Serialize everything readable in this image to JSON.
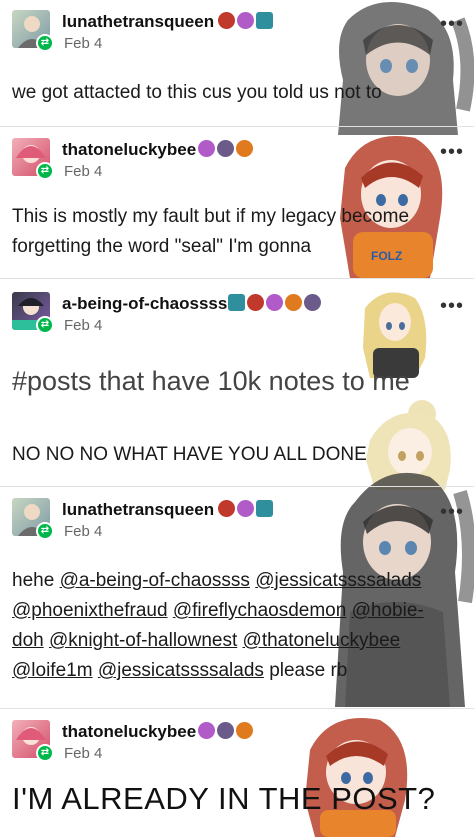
{
  "posts": [
    {
      "username": "lunathetransqueen",
      "date": "Feb 4",
      "body": "we got attacted to this cus you told us not to"
    },
    {
      "username": "thatoneluckybee",
      "date": "Feb 4",
      "body_line1": "This is mostly my fault but if my legacy become",
      "body_line2": "forgetting the word \"seal\" I'm gonna"
    },
    {
      "username": "a-being-of-chaossss",
      "date": "Feb 4",
      "tag": "#posts that have 10k notes to me",
      "body": "NO NO NO WHAT HAVE YOU ALL DONE"
    },
    {
      "username": "lunathetransqueen",
      "date": "Feb 4",
      "body_prefix": "hehe",
      "mentions": [
        "@a-being-of-chaossss",
        "@jessicatssssalads",
        "@phoenixthefraud",
        "@fireflychaosdemon",
        "@hobie-",
        "doh",
        "@knight-of-hallownest",
        "@thatoneluckybee",
        "@loife1m",
        "@jessicatssssalads"
      ],
      "body_suffix": "please rb"
    },
    {
      "username": "thatoneluckybee",
      "date": "Feb 4",
      "body": "I'M ALREADY IN THE POST?"
    }
  ],
  "more_label": "•••",
  "reblog_glyph": "⇄",
  "colors": {
    "reblog_green": "#00b84a",
    "divider": "#e2e2e2",
    "badge_red": "#c0392b",
    "badge_purple": "#b05bc7",
    "badge_teal": "#2f8f9d",
    "badge_orange": "#e07a1f"
  },
  "icons": [
    "reblog-icon",
    "more-options-icon",
    "user-badge-icon"
  ]
}
